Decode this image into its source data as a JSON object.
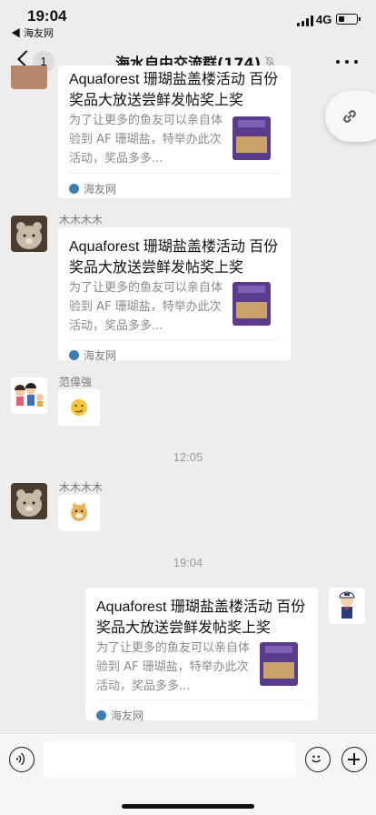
{
  "status": {
    "time": "19:04",
    "back_app": "◀ 海友网",
    "network": "4G"
  },
  "nav": {
    "unread_count": "1",
    "title": "海水自由交流群(174)"
  },
  "card": {
    "title": "Aquaforest 珊瑚盐盖楼活动 百份奖品大放送尝鲜发帖奖上奖",
    "description": "为了让更多的鱼友可以亲自体验到 AF 珊瑚盐，特举办此次活动，奖品多多...",
    "source": "海友网"
  },
  "messages": [
    {
      "sender": "木木木木"
    },
    {
      "sender": "范偉強"
    },
    {
      "timestamp": "12:05"
    },
    {
      "sender": "木木木木"
    },
    {
      "timestamp": "19:04"
    }
  ],
  "colors": {
    "background": "#ededed",
    "bubble": "#ffffff",
    "meta_text": "#7a7a7a"
  }
}
